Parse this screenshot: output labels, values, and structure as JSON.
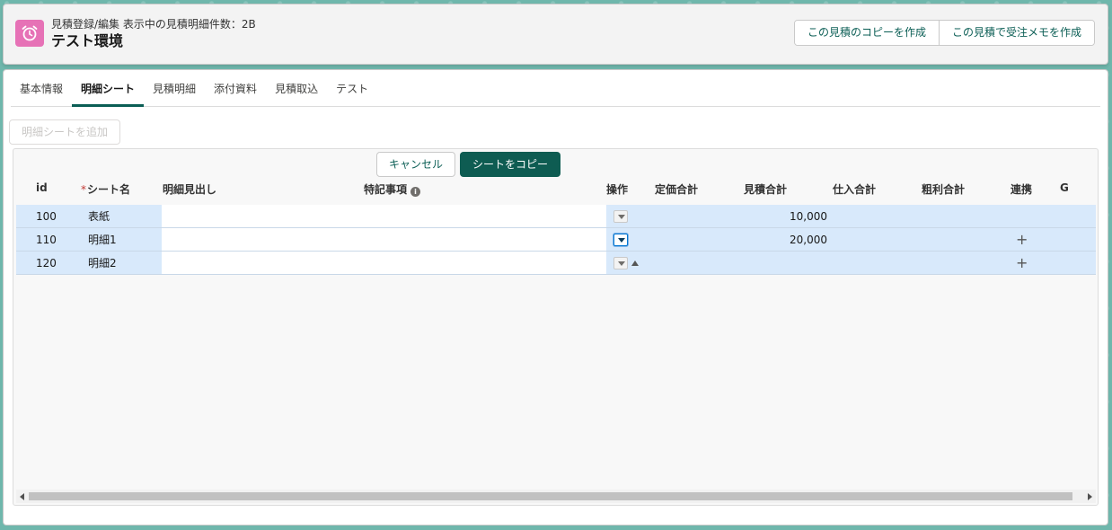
{
  "header": {
    "subtitle": "見積登録/編集 表示中の見積明細件数：2B",
    "title": "テスト環境",
    "icon": "alarm-clock-icon",
    "buttons": {
      "copy_quote": "この見積のコピーを作成",
      "create_order_memo": "この見積で受注メモを作成"
    }
  },
  "tabs": [
    {
      "label": "基本情報",
      "active": false
    },
    {
      "label": "明細シート",
      "active": true
    },
    {
      "label": "見積明細",
      "active": false
    },
    {
      "label": "添付資料",
      "active": false
    },
    {
      "label": "見積取込",
      "active": false
    },
    {
      "label": "テスト",
      "active": false
    }
  ],
  "toolbar": {
    "add_sheet_label": "明細シートを追加",
    "cancel_label": "キャンセル",
    "copy_sheet_label": "シートをコピー"
  },
  "grid": {
    "required_mark": "*",
    "columns": {
      "id": "id",
      "sheet_name": "シート名",
      "heading": "明細見出し",
      "special_notes": "特記事項",
      "actions": "操作",
      "list_total": "定価合計",
      "quote_total": "見積合計",
      "purchase_total": "仕入合計",
      "gross_profit_total": "粗利合計",
      "link": "連携",
      "g": "G"
    },
    "rows": [
      {
        "id": "100",
        "sheet_name": "表紙",
        "quote_total": "10,000",
        "link": ""
      },
      {
        "id": "110",
        "sheet_name": "明細1",
        "quote_total": "20,000",
        "link": "+"
      },
      {
        "id": "120",
        "sheet_name": "明細2",
        "quote_total": "",
        "link": "+"
      }
    ]
  },
  "colors": {
    "accent": "#0e5c52",
    "icon_bg": "#e672b6",
    "row_bg": "#d8e9fb"
  }
}
